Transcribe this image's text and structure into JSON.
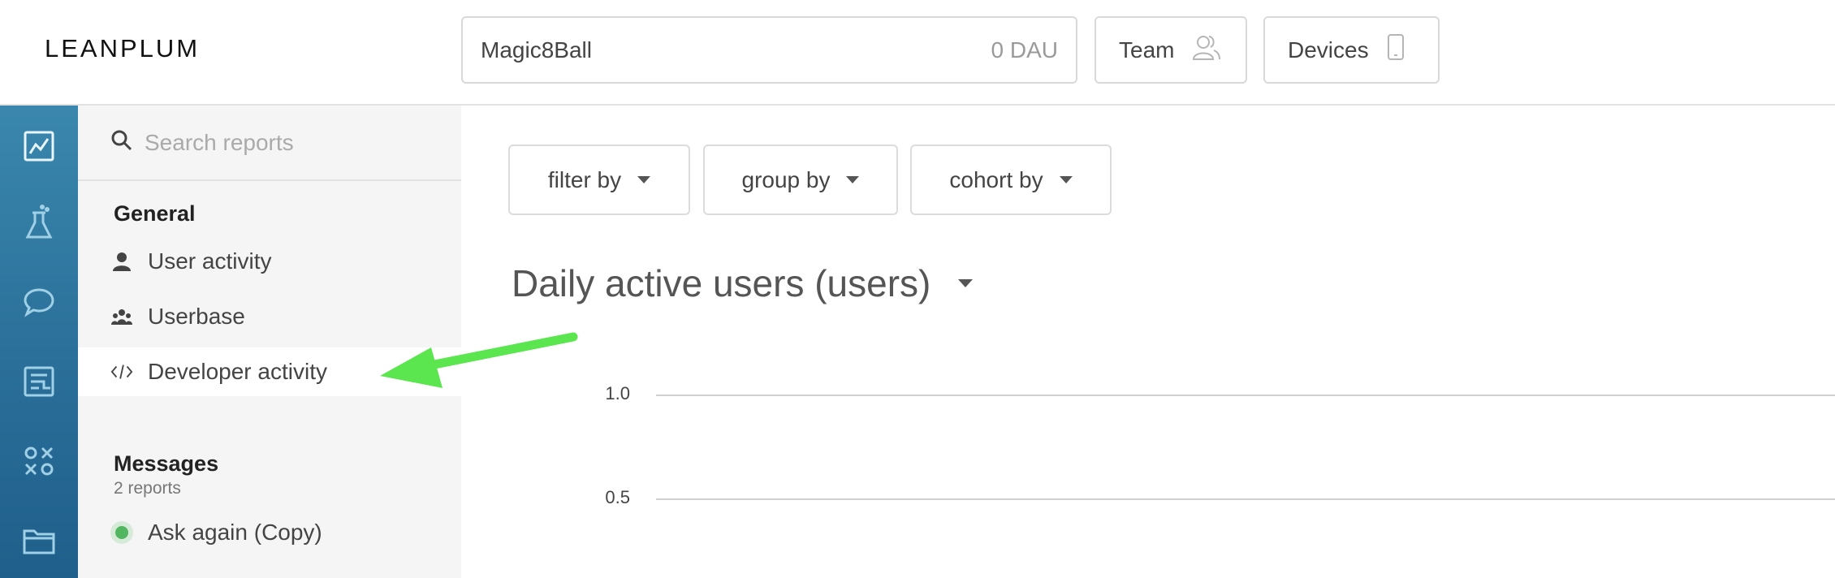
{
  "header": {
    "logo": "LEANPLUM",
    "app_name": "Magic8Ball",
    "dau": "0 DAU",
    "team_label": "Team",
    "devices_label": "Devices"
  },
  "rail": {
    "icons": [
      "analytics-icon",
      "ab-test-icon",
      "messages-icon",
      "campaign-icon",
      "variables-icon",
      "files-icon"
    ]
  },
  "sidebar": {
    "search_placeholder": "Search reports",
    "general": {
      "title": "General",
      "items": [
        {
          "label": "User activity",
          "icon": "user-icon"
        },
        {
          "label": "Userbase",
          "icon": "userbase-icon"
        },
        {
          "label": "Developer activity",
          "icon": "code-icon"
        }
      ]
    },
    "messages": {
      "title": "Messages",
      "subtitle": "2 reports",
      "items": [
        {
          "label": "Ask again (Copy)",
          "icon": "status-dot-icon"
        }
      ]
    }
  },
  "main": {
    "filters": [
      "filter by",
      "group by",
      "cohort by"
    ],
    "report_title": "Daily active users (users)"
  },
  "chart_data": {
    "type": "line",
    "title": "Daily active users (users)",
    "y_ticks": [
      "1.0",
      "0.5"
    ],
    "ylim": [
      0,
      1.0
    ],
    "series": [],
    "grid": true
  },
  "colors": {
    "rail_top": "#3a87ad",
    "rail_bottom": "#1f5f8b",
    "annotation_arrow": "#5be64f",
    "status_green": "#52b560"
  }
}
